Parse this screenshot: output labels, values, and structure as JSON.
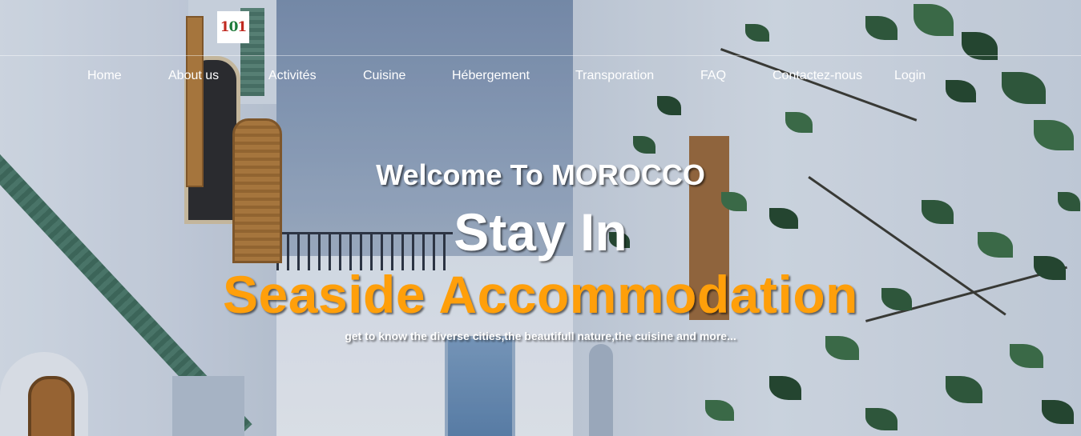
{
  "header": {
    "logo_text": "101"
  },
  "nav": {
    "items": [
      {
        "label": "Home"
      },
      {
        "label": "About us"
      },
      {
        "label": "Activités"
      },
      {
        "label": "Cuisine"
      },
      {
        "label": "Hébergement"
      },
      {
        "label": "Transporation"
      },
      {
        "label": "FAQ"
      },
      {
        "label": "Contactez-nous"
      },
      {
        "label": "Login"
      }
    ]
  },
  "hero": {
    "welcome": "Welcome To MOROCCO",
    "stay": "Stay In",
    "highlight": "Seaside Accommodation",
    "tagline": "get to know the diverse cities,the beautifull nature,the cuisine and more...",
    "highlight_color": "#ff9f0a"
  }
}
